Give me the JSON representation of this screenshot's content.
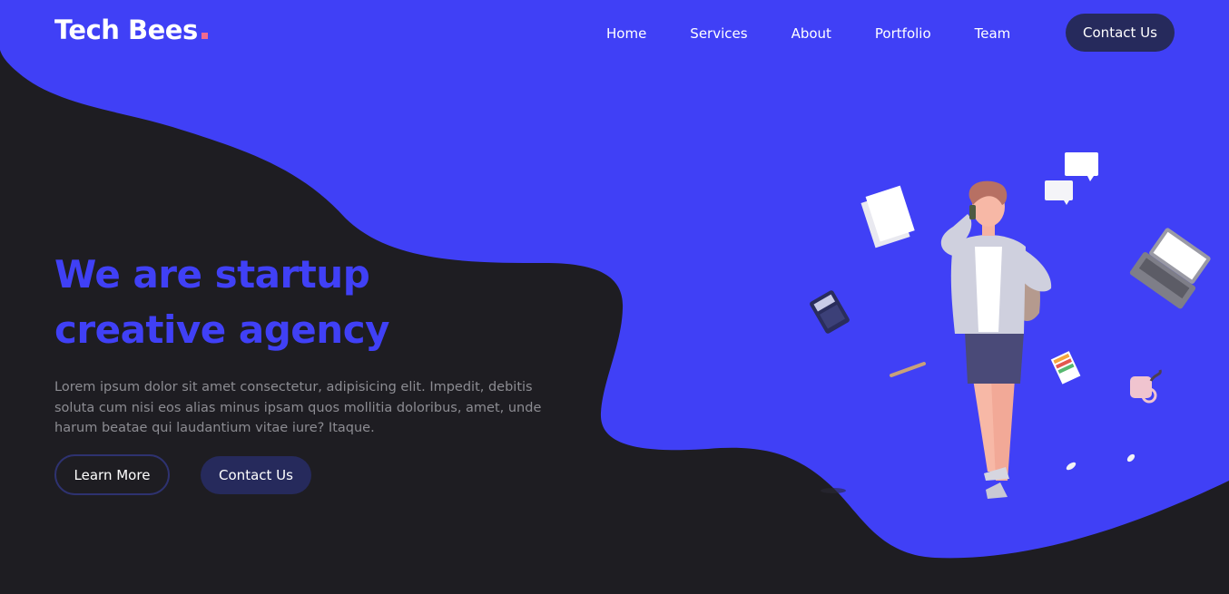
{
  "brand": {
    "name": "Tech Bees"
  },
  "nav": {
    "items": [
      "Home",
      "Services",
      "About",
      "Portfolio",
      "Team"
    ],
    "cta_label": "Contact Us"
  },
  "hero": {
    "title_line1": "We are startup",
    "title_line2": "creative agency",
    "description": "Lorem ipsum dolor sit amet consectetur, adipisicing elit. Impedit, debitis soluta cum nisi eos alias minus ipsam quos mollitia doloribus, amet, unde harum beatae qui laudantium vitae iure? Itaque.",
    "learn_more_label": "Learn More",
    "contact_label": "Contact Us"
  },
  "colors": {
    "accent": "#4040f6",
    "background": "#1e1d22",
    "button": "#262a5c",
    "logo_dot": "#f06a8f"
  }
}
